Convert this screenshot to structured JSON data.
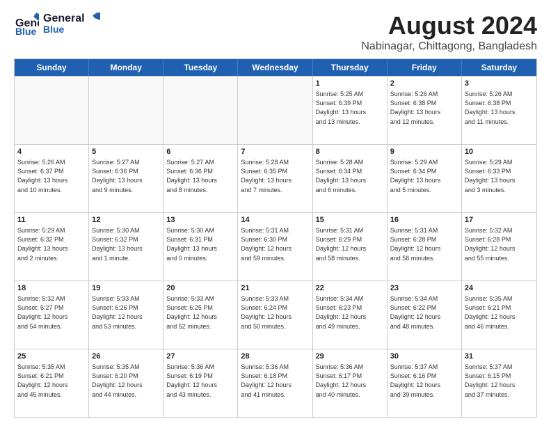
{
  "header": {
    "logo_line1": "General",
    "logo_line2": "Blue",
    "title": "August 2024",
    "subtitle": "Nabinagar, Chittagong, Bangladesh"
  },
  "weekdays": [
    "Sunday",
    "Monday",
    "Tuesday",
    "Wednesday",
    "Thursday",
    "Friday",
    "Saturday"
  ],
  "weeks": [
    [
      {
        "day": "",
        "info": ""
      },
      {
        "day": "",
        "info": ""
      },
      {
        "day": "",
        "info": ""
      },
      {
        "day": "",
        "info": ""
      },
      {
        "day": "1",
        "info": "Sunrise: 5:25 AM\nSunset: 6:39 PM\nDaylight: 13 hours\nand 13 minutes."
      },
      {
        "day": "2",
        "info": "Sunrise: 5:26 AM\nSunset: 6:38 PM\nDaylight: 13 hours\nand 12 minutes."
      },
      {
        "day": "3",
        "info": "Sunrise: 5:26 AM\nSunset: 6:38 PM\nDaylight: 13 hours\nand 11 minutes."
      }
    ],
    [
      {
        "day": "4",
        "info": "Sunrise: 5:26 AM\nSunset: 6:37 PM\nDaylight: 13 hours\nand 10 minutes."
      },
      {
        "day": "5",
        "info": "Sunrise: 5:27 AM\nSunset: 6:36 PM\nDaylight: 13 hours\nand 9 minutes."
      },
      {
        "day": "6",
        "info": "Sunrise: 5:27 AM\nSunset: 6:36 PM\nDaylight: 13 hours\nand 8 minutes."
      },
      {
        "day": "7",
        "info": "Sunrise: 5:28 AM\nSunset: 6:35 PM\nDaylight: 13 hours\nand 7 minutes."
      },
      {
        "day": "8",
        "info": "Sunrise: 5:28 AM\nSunset: 6:34 PM\nDaylight: 13 hours\nand 6 minutes."
      },
      {
        "day": "9",
        "info": "Sunrise: 5:29 AM\nSunset: 6:34 PM\nDaylight: 13 hours\nand 5 minutes."
      },
      {
        "day": "10",
        "info": "Sunrise: 5:29 AM\nSunset: 6:33 PM\nDaylight: 13 hours\nand 3 minutes."
      }
    ],
    [
      {
        "day": "11",
        "info": "Sunrise: 5:29 AM\nSunset: 6:32 PM\nDaylight: 13 hours\nand 2 minutes."
      },
      {
        "day": "12",
        "info": "Sunrise: 5:30 AM\nSunset: 6:32 PM\nDaylight: 13 hours\nand 1 minute."
      },
      {
        "day": "13",
        "info": "Sunrise: 5:30 AM\nSunset: 6:31 PM\nDaylight: 13 hours\nand 0 minutes."
      },
      {
        "day": "14",
        "info": "Sunrise: 5:31 AM\nSunset: 6:30 PM\nDaylight: 12 hours\nand 59 minutes."
      },
      {
        "day": "15",
        "info": "Sunrise: 5:31 AM\nSunset: 6:29 PM\nDaylight: 12 hours\nand 58 minutes."
      },
      {
        "day": "16",
        "info": "Sunrise: 5:31 AM\nSunset: 6:28 PM\nDaylight: 12 hours\nand 56 minutes."
      },
      {
        "day": "17",
        "info": "Sunrise: 5:32 AM\nSunset: 6:28 PM\nDaylight: 12 hours\nand 55 minutes."
      }
    ],
    [
      {
        "day": "18",
        "info": "Sunrise: 5:32 AM\nSunset: 6:27 PM\nDaylight: 12 hours\nand 54 minutes."
      },
      {
        "day": "19",
        "info": "Sunrise: 5:33 AM\nSunset: 6:26 PM\nDaylight: 12 hours\nand 53 minutes."
      },
      {
        "day": "20",
        "info": "Sunrise: 5:33 AM\nSunset: 6:25 PM\nDaylight: 12 hours\nand 52 minutes."
      },
      {
        "day": "21",
        "info": "Sunrise: 5:33 AM\nSunset: 6:24 PM\nDaylight: 12 hours\nand 50 minutes."
      },
      {
        "day": "22",
        "info": "Sunrise: 5:34 AM\nSunset: 6:23 PM\nDaylight: 12 hours\nand 49 minutes."
      },
      {
        "day": "23",
        "info": "Sunrise: 5:34 AM\nSunset: 6:22 PM\nDaylight: 12 hours\nand 48 minutes."
      },
      {
        "day": "24",
        "info": "Sunrise: 5:35 AM\nSunset: 6:21 PM\nDaylight: 12 hours\nand 46 minutes."
      }
    ],
    [
      {
        "day": "25",
        "info": "Sunrise: 5:35 AM\nSunset: 6:21 PM\nDaylight: 12 hours\nand 45 minutes."
      },
      {
        "day": "26",
        "info": "Sunrise: 5:35 AM\nSunset: 6:20 PM\nDaylight: 12 hours\nand 44 minutes."
      },
      {
        "day": "27",
        "info": "Sunrise: 5:36 AM\nSunset: 6:19 PM\nDaylight: 12 hours\nand 43 minutes."
      },
      {
        "day": "28",
        "info": "Sunrise: 5:36 AM\nSunset: 6:18 PM\nDaylight: 12 hours\nand 41 minutes."
      },
      {
        "day": "29",
        "info": "Sunrise: 5:36 AM\nSunset: 6:17 PM\nDaylight: 12 hours\nand 40 minutes."
      },
      {
        "day": "30",
        "info": "Sunrise: 5:37 AM\nSunset: 6:16 PM\nDaylight: 12 hours\nand 39 minutes."
      },
      {
        "day": "31",
        "info": "Sunrise: 5:37 AM\nSunset: 6:15 PM\nDaylight: 12 hours\nand 37 minutes."
      }
    ]
  ]
}
